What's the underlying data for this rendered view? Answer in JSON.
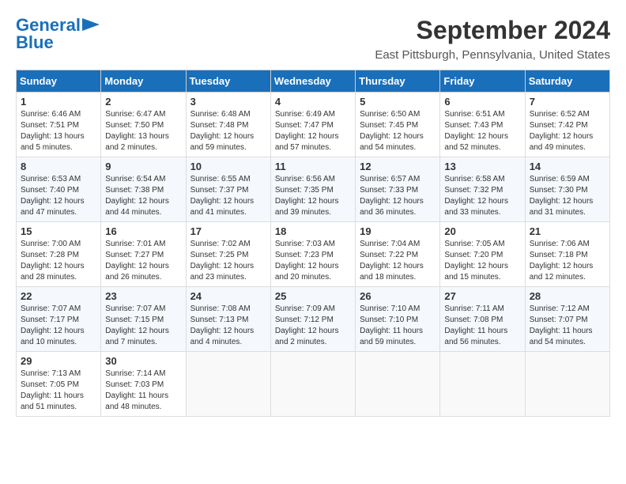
{
  "logo": {
    "line1": "General",
    "line2": "Blue"
  },
  "title": "September 2024",
  "location": "East Pittsburgh, Pennsylvania, United States",
  "days_of_week": [
    "Sunday",
    "Monday",
    "Tuesday",
    "Wednesday",
    "Thursday",
    "Friday",
    "Saturday"
  ],
  "weeks": [
    [
      {
        "day": "1",
        "info": "Sunrise: 6:46 AM\nSunset: 7:51 PM\nDaylight: 13 hours\nand 5 minutes."
      },
      {
        "day": "2",
        "info": "Sunrise: 6:47 AM\nSunset: 7:50 PM\nDaylight: 13 hours\nand 2 minutes."
      },
      {
        "day": "3",
        "info": "Sunrise: 6:48 AM\nSunset: 7:48 PM\nDaylight: 12 hours\nand 59 minutes."
      },
      {
        "day": "4",
        "info": "Sunrise: 6:49 AM\nSunset: 7:47 PM\nDaylight: 12 hours\nand 57 minutes."
      },
      {
        "day": "5",
        "info": "Sunrise: 6:50 AM\nSunset: 7:45 PM\nDaylight: 12 hours\nand 54 minutes."
      },
      {
        "day": "6",
        "info": "Sunrise: 6:51 AM\nSunset: 7:43 PM\nDaylight: 12 hours\nand 52 minutes."
      },
      {
        "day": "7",
        "info": "Sunrise: 6:52 AM\nSunset: 7:42 PM\nDaylight: 12 hours\nand 49 minutes."
      }
    ],
    [
      {
        "day": "8",
        "info": "Sunrise: 6:53 AM\nSunset: 7:40 PM\nDaylight: 12 hours\nand 47 minutes."
      },
      {
        "day": "9",
        "info": "Sunrise: 6:54 AM\nSunset: 7:38 PM\nDaylight: 12 hours\nand 44 minutes."
      },
      {
        "day": "10",
        "info": "Sunrise: 6:55 AM\nSunset: 7:37 PM\nDaylight: 12 hours\nand 41 minutes."
      },
      {
        "day": "11",
        "info": "Sunrise: 6:56 AM\nSunset: 7:35 PM\nDaylight: 12 hours\nand 39 minutes."
      },
      {
        "day": "12",
        "info": "Sunrise: 6:57 AM\nSunset: 7:33 PM\nDaylight: 12 hours\nand 36 minutes."
      },
      {
        "day": "13",
        "info": "Sunrise: 6:58 AM\nSunset: 7:32 PM\nDaylight: 12 hours\nand 33 minutes."
      },
      {
        "day": "14",
        "info": "Sunrise: 6:59 AM\nSunset: 7:30 PM\nDaylight: 12 hours\nand 31 minutes."
      }
    ],
    [
      {
        "day": "15",
        "info": "Sunrise: 7:00 AM\nSunset: 7:28 PM\nDaylight: 12 hours\nand 28 minutes."
      },
      {
        "day": "16",
        "info": "Sunrise: 7:01 AM\nSunset: 7:27 PM\nDaylight: 12 hours\nand 26 minutes."
      },
      {
        "day": "17",
        "info": "Sunrise: 7:02 AM\nSunset: 7:25 PM\nDaylight: 12 hours\nand 23 minutes."
      },
      {
        "day": "18",
        "info": "Sunrise: 7:03 AM\nSunset: 7:23 PM\nDaylight: 12 hours\nand 20 minutes."
      },
      {
        "day": "19",
        "info": "Sunrise: 7:04 AM\nSunset: 7:22 PM\nDaylight: 12 hours\nand 18 minutes."
      },
      {
        "day": "20",
        "info": "Sunrise: 7:05 AM\nSunset: 7:20 PM\nDaylight: 12 hours\nand 15 minutes."
      },
      {
        "day": "21",
        "info": "Sunrise: 7:06 AM\nSunset: 7:18 PM\nDaylight: 12 hours\nand 12 minutes."
      }
    ],
    [
      {
        "day": "22",
        "info": "Sunrise: 7:07 AM\nSunset: 7:17 PM\nDaylight: 12 hours\nand 10 minutes."
      },
      {
        "day": "23",
        "info": "Sunrise: 7:07 AM\nSunset: 7:15 PM\nDaylight: 12 hours\nand 7 minutes."
      },
      {
        "day": "24",
        "info": "Sunrise: 7:08 AM\nSunset: 7:13 PM\nDaylight: 12 hours\nand 4 minutes."
      },
      {
        "day": "25",
        "info": "Sunrise: 7:09 AM\nSunset: 7:12 PM\nDaylight: 12 hours\nand 2 minutes."
      },
      {
        "day": "26",
        "info": "Sunrise: 7:10 AM\nSunset: 7:10 PM\nDaylight: 11 hours\nand 59 minutes."
      },
      {
        "day": "27",
        "info": "Sunrise: 7:11 AM\nSunset: 7:08 PM\nDaylight: 11 hours\nand 56 minutes."
      },
      {
        "day": "28",
        "info": "Sunrise: 7:12 AM\nSunset: 7:07 PM\nDaylight: 11 hours\nand 54 minutes."
      }
    ],
    [
      {
        "day": "29",
        "info": "Sunrise: 7:13 AM\nSunset: 7:05 PM\nDaylight: 11 hours\nand 51 minutes."
      },
      {
        "day": "30",
        "info": "Sunrise: 7:14 AM\nSunset: 7:03 PM\nDaylight: 11 hours\nand 48 minutes."
      },
      {
        "day": "",
        "info": ""
      },
      {
        "day": "",
        "info": ""
      },
      {
        "day": "",
        "info": ""
      },
      {
        "day": "",
        "info": ""
      },
      {
        "day": "",
        "info": ""
      }
    ]
  ]
}
